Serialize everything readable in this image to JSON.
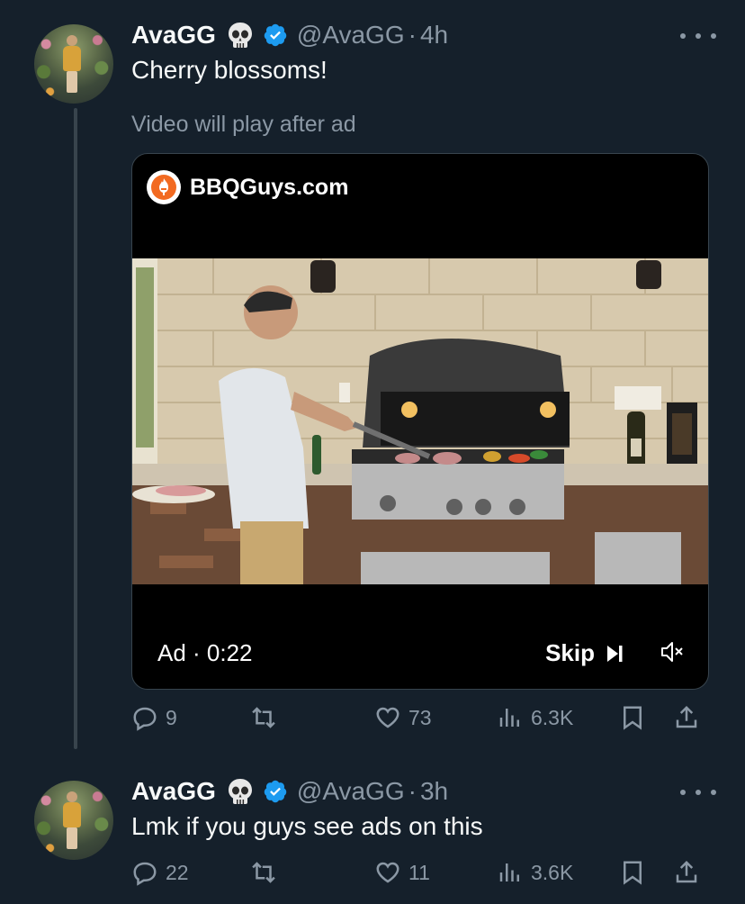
{
  "colors": {
    "background": "#15202b",
    "text": "#f7f9f9",
    "muted": "#8b98a5",
    "verified": "#1d9bf0",
    "brand": "#f26a21"
  },
  "tweets": [
    {
      "display_name": "AvaGG",
      "emoji": "skull",
      "handle": "@AvaGG",
      "separator": "·",
      "time": "4h",
      "text": "Cherry blossoms!",
      "ad": {
        "notice": "Video will play after ad",
        "brand": "BBQGuys.com",
        "label": "Ad · 0:22",
        "skip_label": "Skip"
      },
      "replies": "9",
      "reposts": "",
      "likes": "73",
      "views": "6.3K"
    },
    {
      "display_name": "AvaGG",
      "emoji": "skull",
      "handle": "@AvaGG",
      "separator": "·",
      "time": "3h",
      "text": "Lmk if you guys see ads on this",
      "replies": "22",
      "reposts": "",
      "likes": "11",
      "views": "3.6K"
    }
  ]
}
